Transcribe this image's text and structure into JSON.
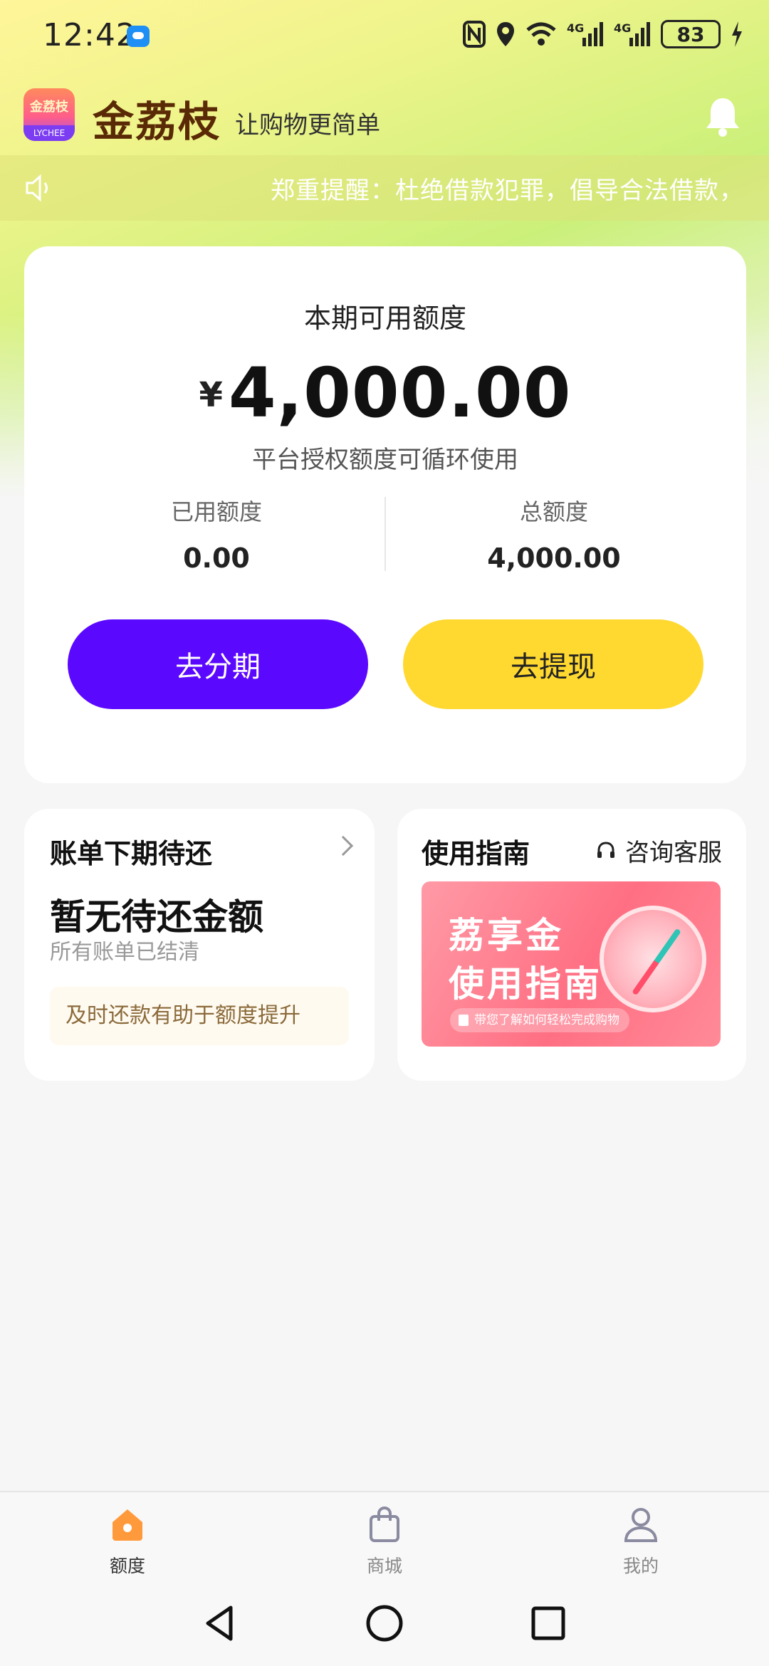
{
  "status_bar": {
    "time": "12:42",
    "network1": "4G",
    "network2": "4G",
    "battery": "83"
  },
  "header": {
    "logo_top": "金荔枝",
    "logo_bottom": "LYCHEE",
    "title": "金荔枝",
    "slogan": "让购物更简单"
  },
  "notice": {
    "text": "郑重提醒：杜绝借款犯罪，倡导合法借款，"
  },
  "quota": {
    "title": "本期可用额度",
    "currency": "¥",
    "amount": "4,000.00",
    "description": "平台授权额度可循环使用",
    "used_label": "已用额度",
    "used_value": "0.00",
    "total_label": "总额度",
    "total_value": "4,000.00",
    "installment_button": "去分期",
    "withdraw_button": "去提现"
  },
  "bill": {
    "title": "账单下期待还",
    "empty": "暂无待还金额",
    "subtitle": "所有账单已结清",
    "tip": "及时还款有助于额度提升"
  },
  "guide": {
    "title": "使用指南",
    "service": "咨询客服",
    "banner_line1": "荔享金",
    "banner_line2": "使用指南",
    "banner_pill": "带您了解如何轻松完成购物"
  },
  "nav": {
    "items": [
      {
        "label": "额度",
        "icon": "home-icon",
        "active": true
      },
      {
        "label": "商城",
        "icon": "shopping-bag-icon",
        "active": false
      },
      {
        "label": "我的",
        "icon": "user-icon",
        "active": false
      }
    ]
  },
  "colors": {
    "primary_purple": "#5b08ff",
    "accent_yellow": "#ffd930",
    "active_orange": "#ff9a3c"
  }
}
